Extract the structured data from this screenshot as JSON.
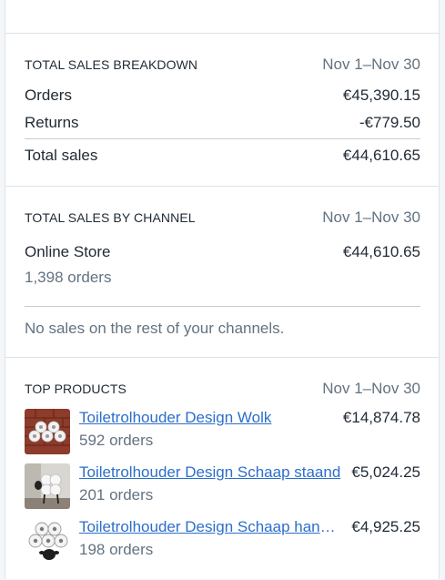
{
  "breakdown": {
    "title": "TOTAL SALES BREAKDOWN",
    "range": "Nov 1–Nov 30",
    "orders_label": "Orders",
    "orders_value": "€45,390.15",
    "returns_label": "Returns",
    "returns_value": "-€779.50",
    "total_label": "Total sales",
    "total_value": "€44,610.65"
  },
  "channel": {
    "title": "TOTAL SALES BY CHANNEL",
    "range": "Nov 1–Nov 30",
    "store_label": "Online Store",
    "store_value": "€44,610.65",
    "store_orders": "1,398 orders",
    "note": "No sales on the rest of your channels."
  },
  "top_products": {
    "title": "TOP PRODUCTS",
    "range": "Nov 1–Nov 30",
    "items": [
      {
        "name": "Toiletrolhouder Design Wolk",
        "orders": "592 orders",
        "value": "€14,874.78",
        "thumb": "brick-wall-cloud-holder"
      },
      {
        "name": "Toiletrolhouder Design Schaap staand",
        "orders": "201 orders",
        "value": "€5,024.25",
        "thumb": "standing-sheep-holder"
      },
      {
        "name": "Toiletrolhouder Design Schaap hangend",
        "orders": "198 orders",
        "value": "€4,925.25",
        "thumb": "hanging-sheep-holder"
      }
    ]
  },
  "colors": {
    "link": "#2c6ecb",
    "muted": "#637381",
    "text": "#212b36"
  }
}
